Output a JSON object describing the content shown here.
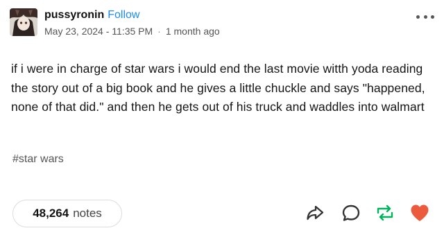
{
  "post": {
    "username": "pussyronin",
    "follow_label": "Follow",
    "date": "May 23, 2024 - 11:35 PM",
    "separator": "·",
    "relative_time": "1 month ago",
    "body": "if i were in charge of star wars i would end the last movie witth yoda reading the story out of a big book and he gives a little chuckle and says \"happened, none of that did.\" and then he gets out of his truck and waddles into walmart",
    "tags": [
      "#star wars"
    ]
  },
  "footer": {
    "notes_count": "48,264",
    "notes_label": "notes"
  },
  "icons": {
    "more": "more-options-icon",
    "share": "share-icon",
    "reply": "reply-icon",
    "reblog": "reblog-icon",
    "like": "heart-icon"
  },
  "colors": {
    "follow": "#1d8bf1",
    "reblog": "#00b45a",
    "like": "#ec5a3d"
  }
}
